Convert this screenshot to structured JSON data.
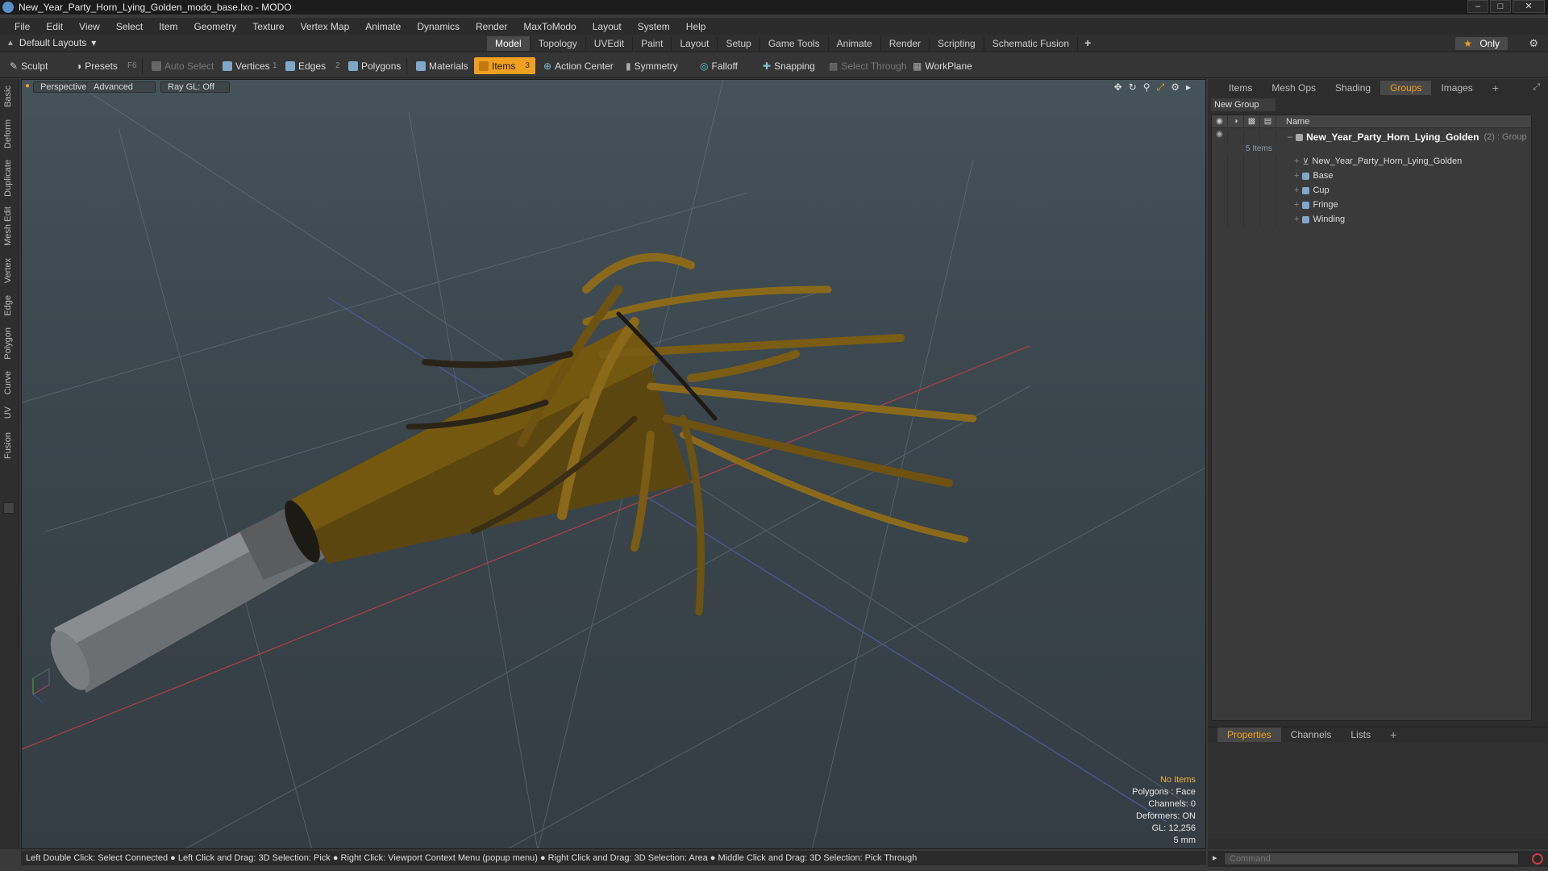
{
  "window": {
    "title": "New_Year_Party_Horn_Lying_Golden_modo_base.lxo - MODO"
  },
  "menu": [
    "File",
    "Edit",
    "View",
    "Select",
    "Item",
    "Geometry",
    "Texture",
    "Vertex Map",
    "Animate",
    "Dynamics",
    "Render",
    "MaxToModo",
    "Layout",
    "System",
    "Help"
  ],
  "layout": {
    "select_label": "Default Layouts",
    "tabs": [
      "Model",
      "Topology",
      "UVEdit",
      "Paint",
      "Layout",
      "Setup",
      "Game Tools",
      "Animate",
      "Render",
      "Scripting",
      "Schematic Fusion"
    ],
    "active_tab": "Model",
    "only_label": "Only"
  },
  "toolbar": {
    "sculpt": "Sculpt",
    "presets": "Presets",
    "presets_key": "F6",
    "auto_select": "Auto Select",
    "vertices": "Vertices",
    "vertices_num": "1",
    "edges": "Edges",
    "edges_num": "2",
    "polygons": "Polygons",
    "materials": "Materials",
    "items": "Items",
    "items_num": "3",
    "action_center": "Action Center",
    "symmetry": "Symmetry",
    "falloff": "Falloff",
    "snapping": "Snapping",
    "select_through": "Select Through",
    "workplane": "WorkPlane"
  },
  "left_tabs": [
    "Basic",
    "Deform",
    "Duplicate",
    "Mesh Edit",
    "Vertex",
    "Edge",
    "Polygon",
    "Curve",
    "UV",
    "Fusion"
  ],
  "viewport": {
    "view_mode": "Perspective",
    "shading": "Advanced",
    "raygl": "Ray GL: Off",
    "status": {
      "no_items": "No Items",
      "polygons": "Polygons : Face",
      "channels": "Channels: 0",
      "deformers": "Deformers: ON",
      "gl": "GL: 12,256",
      "scale": "5 mm"
    }
  },
  "right_panel": {
    "tabs": [
      "Items",
      "Mesh Ops",
      "Shading",
      "Groups",
      "Images"
    ],
    "active_tab": "Groups",
    "new_group": "New Group",
    "name_header": "Name",
    "group": {
      "name": "New_Year_Party_Horn_Lying_Golden",
      "meta": "(2) : Group",
      "count": "5 Items",
      "children": [
        "New_Year_Party_Horn_Lying_Golden",
        "Base",
        "Cup",
        "Fringe",
        "Winding"
      ]
    },
    "bottom_tabs": [
      "Properties",
      "Channels",
      "Lists"
    ],
    "bottom_active": "Properties"
  },
  "statusbar": {
    "hint": "Left Double Click: Select Connected ● Left Click and Drag: 3D Selection: Pick ● Right Click: Viewport Context Menu (popup menu) ● Right Click and Drag: 3D Selection: Area ● Middle Click and Drag: 3D Selection: Pick Through"
  },
  "command": {
    "placeholder": "Command"
  },
  "colors": {
    "accent": "#f0a020",
    "horn_gold": "#6b5410",
    "fringe_gold": "#8a6a1a"
  }
}
